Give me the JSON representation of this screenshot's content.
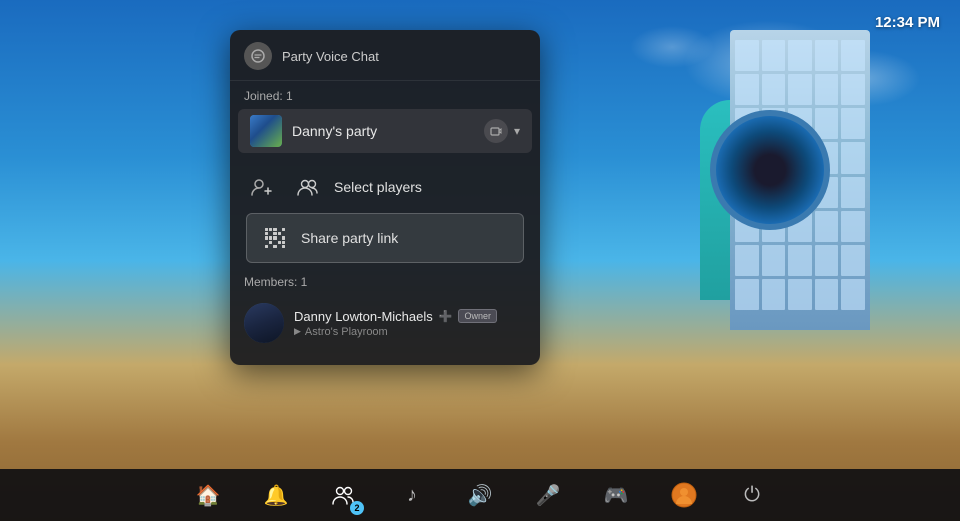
{
  "clock": "12:34 PM",
  "panel": {
    "header_icon": "voice-chat-icon",
    "title": "Party Voice Chat",
    "joined_label": "Joined: 1",
    "party_name": "Danny's party",
    "menu_items": [
      {
        "id": "select-players",
        "icon": "people-icon",
        "label": "Select players",
        "selected": false
      },
      {
        "id": "share-party-link",
        "icon": "qr-icon",
        "label": "Share party link",
        "selected": true
      }
    ],
    "members_label": "Members: 1",
    "member": {
      "name": "Danny Lowton-Michaels",
      "ps_plus": true,
      "owner_badge": "Owner",
      "game": "Astro's Playroom"
    }
  },
  "taskbar": {
    "items": [
      {
        "id": "home",
        "icon": "🏠",
        "active": false,
        "badge": null
      },
      {
        "id": "notifications",
        "icon": "🔔",
        "active": false,
        "badge": null
      },
      {
        "id": "party",
        "icon": "👥",
        "active": true,
        "badge": "2"
      },
      {
        "id": "music",
        "icon": "♪",
        "active": false,
        "badge": null
      },
      {
        "id": "volume",
        "icon": "🔊",
        "active": false,
        "badge": null
      },
      {
        "id": "mic",
        "icon": "🎤",
        "active": false,
        "badge": null
      },
      {
        "id": "gamepad",
        "icon": "🎮",
        "active": false,
        "badge": null
      },
      {
        "id": "avatar",
        "icon": "👤",
        "active": false,
        "badge": null
      },
      {
        "id": "power",
        "icon": "⏻",
        "active": false,
        "badge": null
      }
    ]
  }
}
